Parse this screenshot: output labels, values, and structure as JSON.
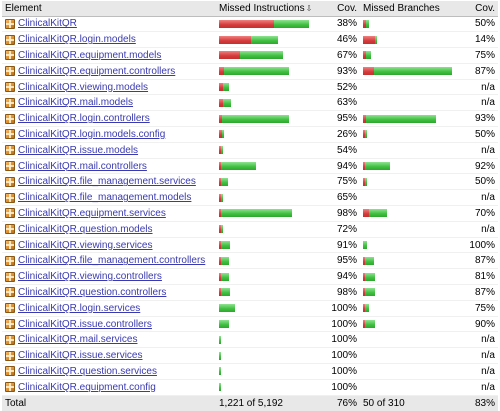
{
  "headers": {
    "element": "Element",
    "missed_instructions": "Missed Instructions",
    "sort_arrow": "⇩",
    "cov1": "Cov.",
    "missed_branches": "Missed Branches",
    "cov2": "Cov."
  },
  "colors": {
    "missed": "#d53b3b",
    "covered": "#3fbf3f",
    "link": "#3a3ab0",
    "header_bg": "#e8e8e8"
  },
  "rows": [
    {
      "name": "ClinicalKitQR",
      "instr_missed_frac": 0.607,
      "instr_covered_frac": 0.385,
      "instr_cov": "38%",
      "br_missed_frac": 0.03,
      "br_covered_frac": 0.03,
      "br_cov": "50%"
    },
    {
      "name": "ClinicalKitQR.login.models",
      "instr_missed_frac": 0.352,
      "instr_covered_frac": 0.3,
      "instr_cov": "46%",
      "br_missed_frac": 0.133,
      "br_covered_frac": 0.02,
      "br_cov": "14%"
    },
    {
      "name": "ClinicalKitQR.equipment.models",
      "instr_missed_frac": 0.231,
      "instr_covered_frac": 0.473,
      "instr_cov": "67%",
      "br_missed_frac": 0.03,
      "br_covered_frac": 0.055,
      "br_cov": "75%"
    },
    {
      "name": "ClinicalKitQR.equipment.controllers",
      "instr_missed_frac": 0.055,
      "instr_covered_frac": 0.714,
      "instr_cov": "93%",
      "br_missed_frac": 0.122,
      "br_covered_frac": 0.867,
      "br_cov": "87%"
    },
    {
      "name": "ClinicalKitQR.viewing.models",
      "instr_missed_frac": 0.044,
      "instr_covered_frac": 0.066,
      "instr_cov": "52%",
      "br_missed_frac": 0,
      "br_covered_frac": 0,
      "br_cov": "n/a"
    },
    {
      "name": "ClinicalKitQR.mail.models",
      "instr_missed_frac": 0.044,
      "instr_covered_frac": 0.088,
      "instr_cov": "63%",
      "br_missed_frac": 0,
      "br_covered_frac": 0,
      "br_cov": "n/a"
    },
    {
      "name": "ClinicalKitQR.login.controllers",
      "instr_missed_frac": 0.03,
      "instr_covered_frac": 0.736,
      "instr_cov": "95%",
      "br_missed_frac": 0.03,
      "br_covered_frac": 0.78,
      "br_cov": "93%"
    },
    {
      "name": "ClinicalKitQR.login.models.config",
      "instr_missed_frac": 0.033,
      "instr_covered_frac": 0.011,
      "instr_cov": "26%",
      "br_missed_frac": 0.01,
      "br_covered_frac": 0.01,
      "br_cov": "50%"
    },
    {
      "name": "ClinicalKitQR.issue.models",
      "instr_missed_frac": 0.01,
      "instr_covered_frac": 0.022,
      "instr_cov": "54%",
      "br_missed_frac": 0,
      "br_covered_frac": 0,
      "br_cov": "n/a"
    },
    {
      "name": "ClinicalKitQR.mail.controllers",
      "instr_missed_frac": 0.022,
      "instr_covered_frac": 0.385,
      "instr_cov": "94%",
      "br_missed_frac": 0.02,
      "br_covered_frac": 0.28,
      "br_cov": "92%"
    },
    {
      "name": "ClinicalKitQR.file_management.services",
      "instr_missed_frac": 0.011,
      "instr_covered_frac": 0.077,
      "instr_cov": "75%",
      "br_missed_frac": 0.01,
      "br_covered_frac": 0.01,
      "br_cov": "50%"
    },
    {
      "name": "ClinicalKitQR.file_management.models",
      "instr_missed_frac": 0.01,
      "instr_covered_frac": 0.022,
      "instr_cov": "65%",
      "br_missed_frac": 0,
      "br_covered_frac": 0,
      "br_cov": "n/a"
    },
    {
      "name": "ClinicalKitQR.equipment.services",
      "instr_missed_frac": 0.011,
      "instr_covered_frac": 0.78,
      "instr_cov": "98%",
      "br_missed_frac": 0.067,
      "br_covered_frac": 0.2,
      "br_cov": "70%"
    },
    {
      "name": "ClinicalKitQR.question.models",
      "instr_missed_frac": 0.01,
      "instr_covered_frac": 0.022,
      "instr_cov": "72%",
      "br_missed_frac": 0,
      "br_covered_frac": 0,
      "br_cov": "n/a"
    },
    {
      "name": "ClinicalKitQR.viewing.services",
      "instr_missed_frac": 0.005,
      "instr_covered_frac": 0.099,
      "instr_cov": "91%",
      "br_missed_frac": 0,
      "br_covered_frac": 0.044,
      "br_cov": "100%"
    },
    {
      "name": "ClinicalKitQR.file_management.controllers",
      "instr_missed_frac": 0.005,
      "instr_covered_frac": 0.088,
      "instr_cov": "95%",
      "br_missed_frac": 0.01,
      "br_covered_frac": 0.1,
      "br_cov": "87%"
    },
    {
      "name": "ClinicalKitQR.viewing.controllers",
      "instr_missed_frac": 0.005,
      "instr_covered_frac": 0.088,
      "instr_cov": "94%",
      "br_missed_frac": 0.022,
      "br_covered_frac": 0.111,
      "br_cov": "81%"
    },
    {
      "name": "ClinicalKitQR.question.controllers",
      "instr_missed_frac": 0.005,
      "instr_covered_frac": 0.099,
      "instr_cov": "98%",
      "br_missed_frac": 0.011,
      "br_covered_frac": 0.111,
      "br_cov": "87%"
    },
    {
      "name": "ClinicalKitQR.login.services",
      "instr_missed_frac": 0,
      "instr_covered_frac": 0.176,
      "instr_cov": "100%",
      "br_missed_frac": 0.01,
      "br_covered_frac": 0.044,
      "br_cov": "75%"
    },
    {
      "name": "ClinicalKitQR.issue.controllers",
      "instr_missed_frac": 0,
      "instr_covered_frac": 0.11,
      "instr_cov": "100%",
      "br_missed_frac": 0.01,
      "br_covered_frac": 0.111,
      "br_cov": "90%"
    },
    {
      "name": "ClinicalKitQR.mail.services",
      "instr_missed_frac": 0,
      "instr_covered_frac": 0.022,
      "instr_cov": "100%",
      "br_missed_frac": 0,
      "br_covered_frac": 0,
      "br_cov": "n/a"
    },
    {
      "name": "ClinicalKitQR.issue.services",
      "instr_missed_frac": 0,
      "instr_covered_frac": 0.022,
      "instr_cov": "100%",
      "br_missed_frac": 0,
      "br_covered_frac": 0,
      "br_cov": "n/a"
    },
    {
      "name": "ClinicalKitQR.question.services",
      "instr_missed_frac": 0,
      "instr_covered_frac": 0.022,
      "instr_cov": "100%",
      "br_missed_frac": 0,
      "br_covered_frac": 0,
      "br_cov": "n/a"
    },
    {
      "name": "ClinicalKitQR.equipment.config",
      "instr_missed_frac": 0,
      "instr_covered_frac": 0.01,
      "instr_cov": "100%",
      "br_missed_frac": 0,
      "br_covered_frac": 0,
      "br_cov": "n/a"
    }
  ],
  "total": {
    "label": "Total",
    "missed_instructions": "1,221 of 5,192",
    "cov1": "76%",
    "missed_branches": "50 of 310",
    "cov2": "83%"
  }
}
